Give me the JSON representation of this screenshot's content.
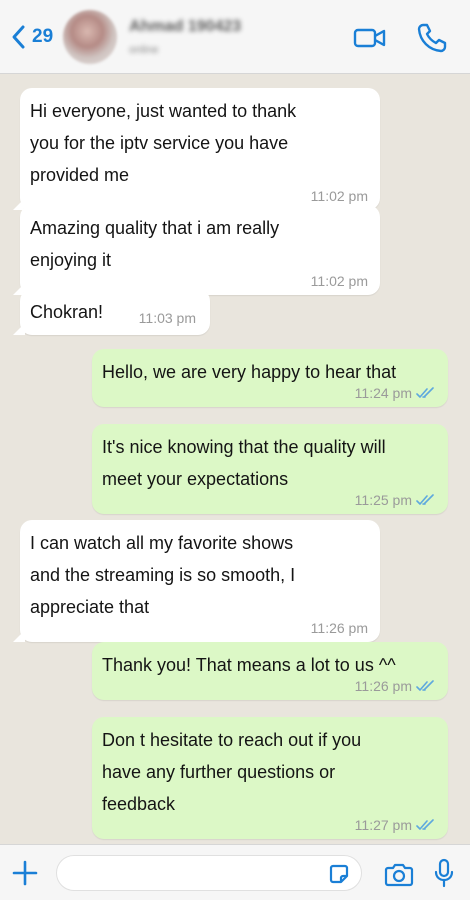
{
  "header": {
    "back_count": "29",
    "contact_name": "Ahmad 190423",
    "contact_status": "online"
  },
  "messages": [
    {
      "direction": "in",
      "lines": [
        "Hi everyone, just wanted to thank",
        "you for the iptv service you have",
        "provided me"
      ],
      "time": "11:02 pm"
    },
    {
      "direction": "in",
      "lines": [
        "Amazing quality that i am really",
        "enjoying it"
      ],
      "time": "11:02 pm"
    },
    {
      "direction": "in",
      "lines": [
        "Chokran!"
      ],
      "time": "11:03 pm"
    },
    {
      "direction": "out",
      "lines": [
        "Hello, we are very happy to hear that"
      ],
      "time": "11:24 pm",
      "status": "read"
    },
    {
      "direction": "out",
      "lines": [
        "It's nice knowing that the quality will",
        "meet your expectations"
      ],
      "time": "11:25 pm",
      "status": "read"
    },
    {
      "direction": "in",
      "lines": [
        "I can watch all my favorite shows",
        "and the streaming is so smooth, I",
        "appreciate that"
      ],
      "time": "11:26 pm"
    },
    {
      "direction": "out",
      "lines": [
        "Thank you! That means a lot to us ^^"
      ],
      "time": "11:26 pm",
      "status": "read"
    },
    {
      "direction": "out",
      "lines": [
        "Don t hesitate to reach out if you",
        "have any further questions or",
        "feedback"
      ],
      "time": "11:27 pm",
      "status": "read"
    }
  ],
  "composer": {
    "value": "",
    "placeholder": ""
  },
  "colors": {
    "accent": "#1a7fd6",
    "outgoing_bubble": "#dcf8c6",
    "incoming_bubble": "#ffffff",
    "chat_background": "#e9e5dd",
    "read_ticks": "#5ea8de"
  },
  "icons": {
    "back": "chevron-left-icon",
    "video": "video-camera-icon",
    "call": "phone-icon",
    "attach": "plus-icon",
    "sticker": "sticker-icon",
    "camera": "camera-icon",
    "mic": "microphone-icon"
  }
}
